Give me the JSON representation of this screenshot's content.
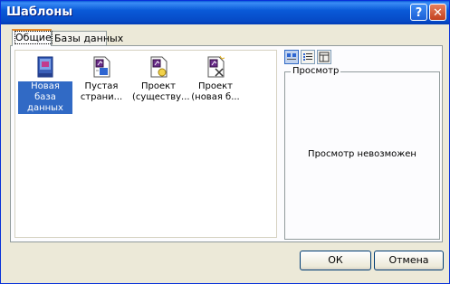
{
  "window": {
    "title": "Шаблоны",
    "help_glyph": "?",
    "close_glyph": "✕"
  },
  "tabs": [
    {
      "label": "Общие",
      "active": true
    },
    {
      "label": "Базы данных",
      "active": false
    }
  ],
  "templates": [
    {
      "label": "Новая база данных",
      "icon": "database-icon",
      "selected": true
    },
    {
      "label": "Пустая страни...",
      "icon": "data-access-page-icon",
      "selected": false
    },
    {
      "label": "Проект (существу...",
      "icon": "project-existing-icon",
      "selected": false
    },
    {
      "label": "Проект (новая б...",
      "icon": "project-new-icon",
      "selected": false
    }
  ],
  "view_buttons": [
    "large-icons-icon",
    "list-icon",
    "details-icon"
  ],
  "preview": {
    "legend": "Просмотр",
    "message": "Просмотр невозможен"
  },
  "buttons": {
    "ok": "ОК",
    "cancel": "Отмена"
  },
  "colors": {
    "titlebar": "#0a5ad8",
    "selection": "#316ac5",
    "tab_highlight": "#e68b2c"
  }
}
